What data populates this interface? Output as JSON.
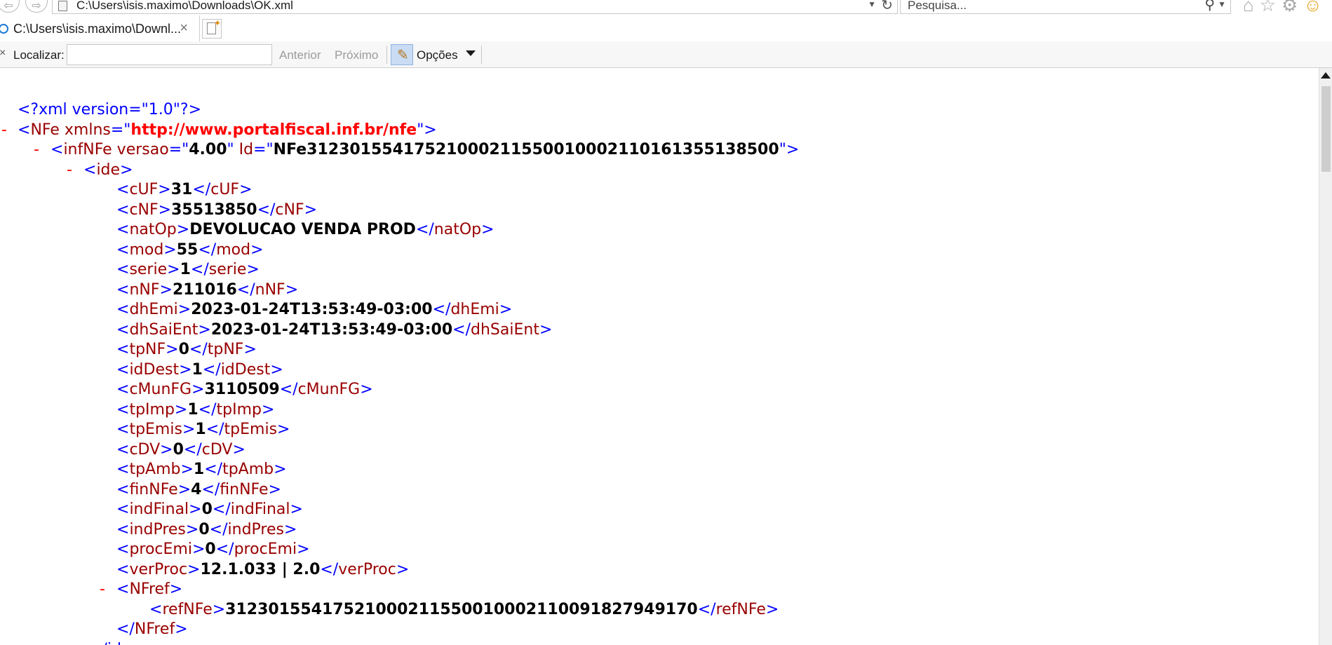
{
  "address_bar": {
    "url": "C:\\Users\\isis.maximo\\Downloads\\OK.xml",
    "search_placeholder": "Pesquisa..."
  },
  "tabs": [
    {
      "title": "C:\\Users\\isis.maximo\\Downl...",
      "close": "×"
    }
  ],
  "find_bar": {
    "close": "×",
    "label": "Localizar:",
    "value": "",
    "previous": "Anterior",
    "next": "Próximo",
    "options": "Opções"
  },
  "xml": {
    "declaration": "<?xml version=\"1.0\"?>",
    "toggle": "-",
    "lines": [
      {
        "tag": "NFe",
        "attr": "xmlns",
        "attr_value": "http://www.portalfiscal.inf.br/nfe"
      },
      {
        "tag": "infNFe",
        "attrs": [
          {
            "name": "versao",
            "value": "4.00"
          },
          {
            "name": "Id",
            "value": "NFe31230155417521000211550010002110161355138500"
          }
        ]
      },
      {
        "tag": "ide"
      }
    ],
    "ide_fields": [
      {
        "tag": "cUF",
        "value": "31"
      },
      {
        "tag": "cNF",
        "value": "35513850"
      },
      {
        "tag": "natOp",
        "value": "DEVOLUCAO VENDA PROD"
      },
      {
        "tag": "mod",
        "value": "55"
      },
      {
        "tag": "serie",
        "value": "1"
      },
      {
        "tag": "nNF",
        "value": "211016"
      },
      {
        "tag": "dhEmi",
        "value": "2023-01-24T13:53:49-03:00"
      },
      {
        "tag": "dhSaiEnt",
        "value": "2023-01-24T13:53:49-03:00"
      },
      {
        "tag": "tpNF",
        "value": "0"
      },
      {
        "tag": "idDest",
        "value": "1"
      },
      {
        "tag": "cMunFG",
        "value": "3110509"
      },
      {
        "tag": "tpImp",
        "value": "1"
      },
      {
        "tag": "tpEmis",
        "value": "1"
      },
      {
        "tag": "cDV",
        "value": "0"
      },
      {
        "tag": "tpAmb",
        "value": "1"
      },
      {
        "tag": "finNFe",
        "value": "4"
      },
      {
        "tag": "indFinal",
        "value": "0"
      },
      {
        "tag": "indPres",
        "value": "0"
      },
      {
        "tag": "procEmi",
        "value": "0"
      },
      {
        "tag": "verProc",
        "value": "12.1.033 | 2.0"
      }
    ],
    "nfref": {
      "tag": "NFref",
      "child_tag": "refNFe",
      "child_value": "31230155417521000211550010002110091827949170"
    },
    "trailing": "</ide>"
  }
}
